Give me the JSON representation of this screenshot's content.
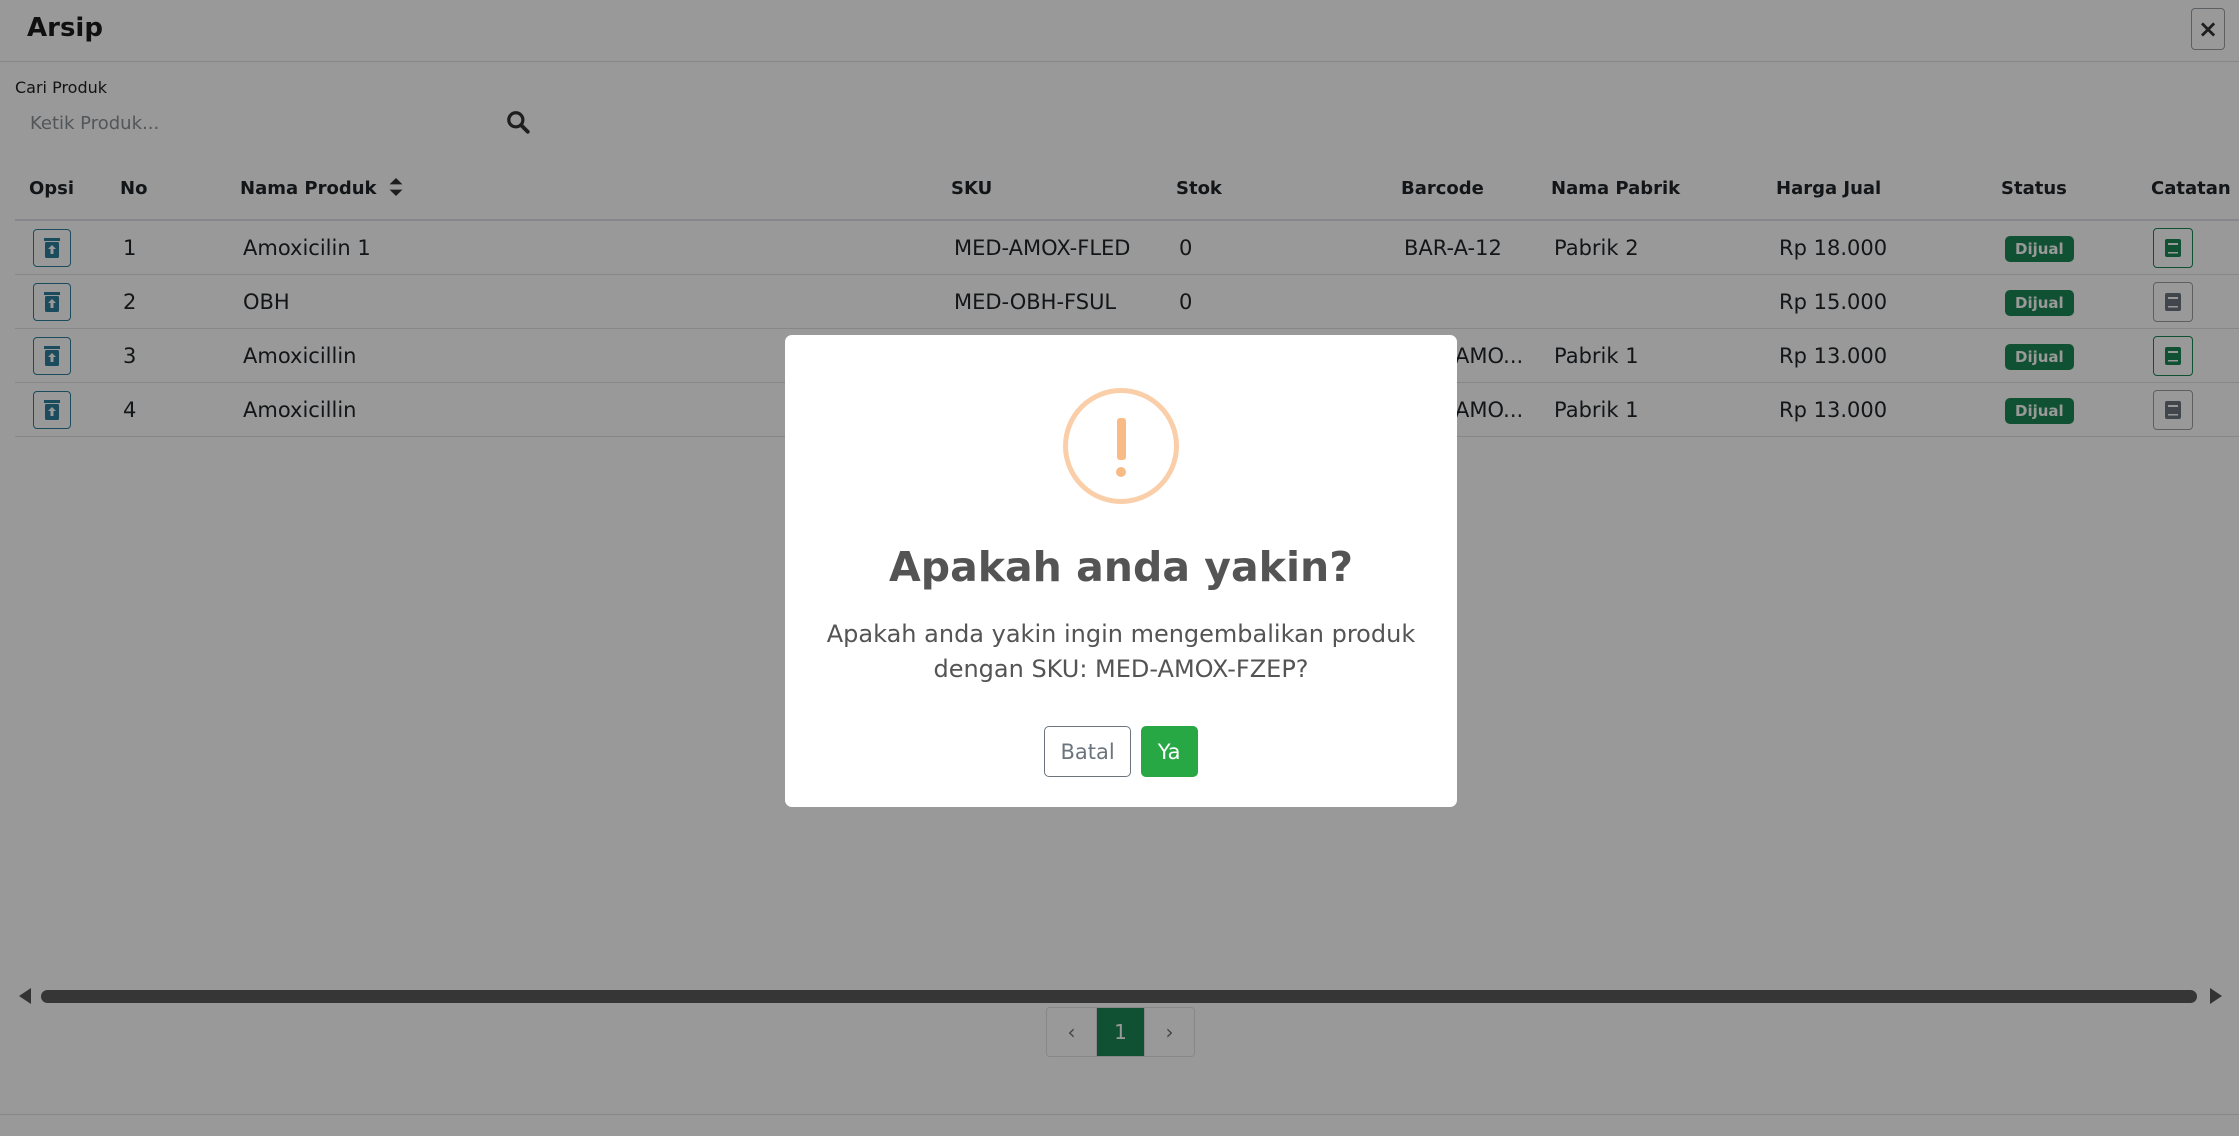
{
  "window": {
    "title": "Arsip",
    "close_label": "×"
  },
  "search": {
    "label": "Cari Produk",
    "placeholder": "Ketik Produk..."
  },
  "table": {
    "headers": {
      "opsi": "Opsi",
      "no": "No",
      "nama_produk": "Nama Produk",
      "sku": "SKU",
      "stok": "Stok",
      "barcode": "Barcode",
      "nama_pabrik": "Nama Pabrik",
      "harga_jual": "Harga Jual",
      "status": "Status",
      "catatan": "Catatan"
    },
    "rows": [
      {
        "no": "1",
        "nama_produk": "Amoxicilin 1",
        "sku": "MED-AMOX-FLED",
        "stok": "0",
        "barcode": "BAR-A-12",
        "nama_pabrik": "Pabrik 2",
        "harga_jual": "Rp 18.000",
        "status": "Dijual",
        "note_color": "green"
      },
      {
        "no": "2",
        "nama_produk": "OBH",
        "sku": "MED-OBH-FSUL",
        "stok": "0",
        "barcode": "",
        "nama_pabrik": "",
        "harga_jual": "Rp 15.000",
        "status": "Dijual",
        "note_color": "grey"
      },
      {
        "no": "3",
        "nama_produk": "Amoxicillin",
        "sku": "",
        "stok": "",
        "barcode": "AMO...",
        "nama_pabrik": "Pabrik 1",
        "harga_jual": "Rp 13.000",
        "status": "Dijual",
        "note_color": "green"
      },
      {
        "no": "4",
        "nama_produk": "Amoxicillin",
        "sku": "",
        "stok": "",
        "barcode": "AMO...",
        "nama_pabrik": "Pabrik 1",
        "harga_jual": "Rp 13.000",
        "status": "Dijual",
        "note_color": "grey"
      }
    ]
  },
  "pagination": {
    "prev": "‹",
    "current": "1",
    "next": "›"
  },
  "dialog": {
    "icon": "warning-icon",
    "title": "Apakah anda yakin?",
    "text_line1": "Apakah anda yakin ingin mengembalikan produk",
    "text_line2": "dengan SKU: MED-AMOX-FZEP?",
    "cancel_label": "Batal",
    "confirm_label": "Ya"
  },
  "colors": {
    "accent_green": "#198754",
    "confirm_green": "#28a745",
    "restore_blue": "#2d7f9c",
    "warning_orange": "#f8bb86"
  }
}
